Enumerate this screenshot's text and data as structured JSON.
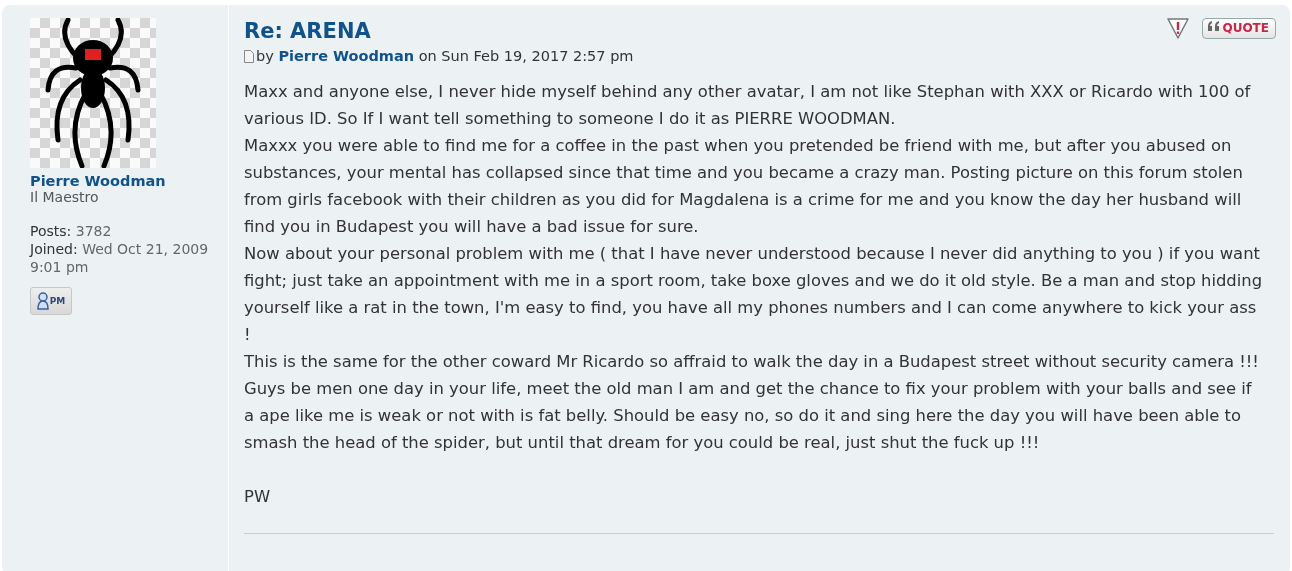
{
  "profile": {
    "username": "Pierre Woodman",
    "rank": "Il Maestro",
    "stats": [
      {
        "label": "Posts:",
        "value": "3782"
      },
      {
        "label": "Joined:",
        "value": "Wed Oct 21, 2009 9:01 pm"
      }
    ],
    "pm_button": "PM"
  },
  "post": {
    "title": "Re: ARENA",
    "by": "by",
    "author": "Pierre Woodman",
    "date": "on Sun Feb 19, 2017 2:57 pm",
    "quote_button": "QUOTE",
    "paragraphs": [
      "Maxx and anyone else, I never hide myself behind any other avatar, I am not like Stephan with XXX or Ricardo with 100 of various ID. So If I want tell something to someone I do it as PIERRE WOODMAN.",
      "Maxxx you were able to find me for a coffee in the past when you pretended be friend with me, but after you abused on substances, your mental has collapsed since that time and you became a crazy man. Posting picture on this forum stolen from girls facebook with their children as you did for Magdalena is a crime for me and you know the day her husband will find you in Budapest you will have a bad issue for sure.",
      "Now about your personal problem with me ( that I have never understood because I never did anything to you ) if you want fight; just take an appointment with me in a sport room, take boxe gloves and we do it old style. Be a man and stop hidding yourself like a rat in the town, I'm easy to find, you have all my phones numbers and I can come anywhere to kick your ass !",
      "This is the same for the other coward Mr Ricardo so affraid to walk the day in a Budapest street without security camera !!!",
      "Guys be men one day in your life, meet the old man I am and get the chance to fix your problem with your balls and see if a ape like me is weak or not with is fat belly. Should be easy no, so do it and sing here the day you will have been able to smash the head of the spider, but until that dream for you could be real, just shut the fuck up !!!"
    ],
    "signature": "PW"
  }
}
